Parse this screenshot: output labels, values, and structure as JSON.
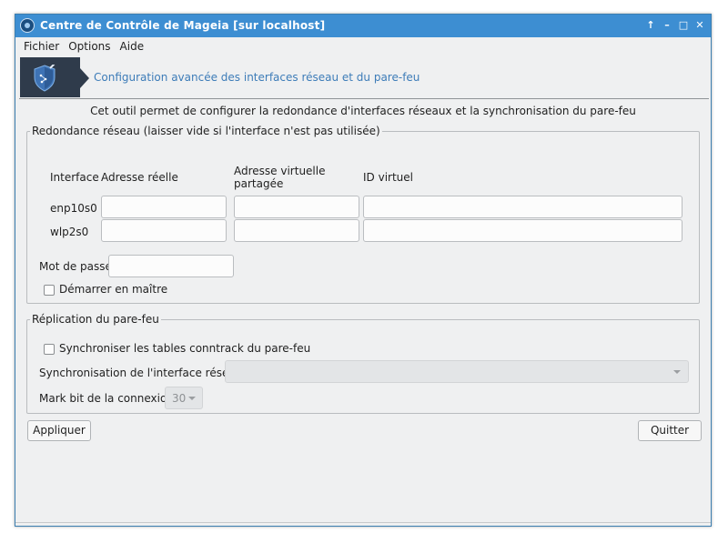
{
  "window": {
    "title": "Centre de Contrôle de Mageia  [sur localhost]",
    "controls": [
      "↑",
      "–",
      "□",
      "✕"
    ]
  },
  "menu": {
    "items": [
      "Fichier",
      "Options",
      "Aide"
    ]
  },
  "banner": {
    "text": "Configuration avancée des interfaces réseau et du pare-feu",
    "icon": "shield-network-icon"
  },
  "description": "Cet outil permet de configurer la redondance d'interfaces réseaux et la synchronisation du pare-feu",
  "redundancy": {
    "title": "Redondance réseau (laisser vide si l'interface n'est pas utilisée)",
    "headers": {
      "interface": "Interface",
      "real_address": "Adresse réelle",
      "virtual_address_1": "Adresse virtuelle",
      "virtual_address_2": "partagée",
      "virtual_id": "ID virtuel"
    },
    "rows": [
      {
        "interface": "enp10s0",
        "real": "",
        "virtual": "",
        "id": ""
      },
      {
        "interface": "wlp2s0",
        "real": "",
        "virtual": "",
        "id": ""
      }
    ],
    "password_label": "Mot de passe",
    "password_value": "",
    "master_label": "Démarrer en maître",
    "master_checked": false
  },
  "firewall": {
    "title": "Réplication du pare-feu",
    "sync_tables_label": "Synchroniser les tables conntrack du pare-feu",
    "sync_tables_checked": false,
    "interface_label": "Synchronisation de l'interface réseau",
    "interface_value": "",
    "markbit_label": "Mark bit de la connexion",
    "markbit_value": "30"
  },
  "buttons": {
    "apply": "Appliquer",
    "quit": "Quitter"
  },
  "colors": {
    "titlebar": "#3d8ed2",
    "banner_text": "#3d7cb8",
    "banner_icon_bg": "#2f3b4b"
  }
}
